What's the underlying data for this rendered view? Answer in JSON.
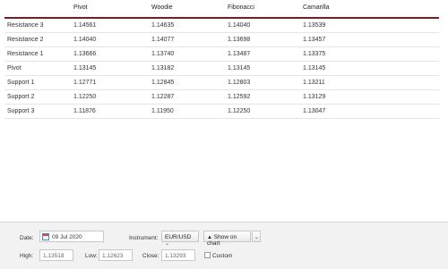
{
  "table": {
    "columns": [
      "",
      "Pivot",
      "Woodie",
      "Fibonacci",
      "Camarilla"
    ],
    "rows": [
      {
        "label": "Resistance 3",
        "pivot": "1.14561",
        "woodie": "1.14635",
        "fibonacci": "1.14040",
        "camarilla": "1.13539"
      },
      {
        "label": "Resistance 2",
        "pivot": "1.14040",
        "woodie": "1.14077",
        "fibonacci": "1.13698",
        "camarilla": "1.13457"
      },
      {
        "label": "Resistance 1",
        "pivot": "1.13666",
        "woodie": "1.13740",
        "fibonacci": "1.13487",
        "camarilla": "1.13375"
      },
      {
        "label": "Pivot",
        "pivot": "1.13145",
        "woodie": "1.13182",
        "fibonacci": "1.13145",
        "camarilla": "1.13145"
      },
      {
        "label": "Support 1",
        "pivot": "1.12771",
        "woodie": "1.12845",
        "fibonacci": "1.12803",
        "camarilla": "1.13211"
      },
      {
        "label": "Support 2",
        "pivot": "1.12250",
        "woodie": "1.12287",
        "fibonacci": "1.12592",
        "camarilla": "1.13129"
      },
      {
        "label": "Support 3",
        "pivot": "1.11876",
        "woodie": "1.11950",
        "fibonacci": "1.12250",
        "camarilla": "1.13047"
      }
    ]
  },
  "controls": {
    "date_label": "Date:",
    "date_value": "09 Jul 2020",
    "instrument_label": "Instrument:",
    "instrument_value": "EUR/USD",
    "show_on_chart_label": "Show on chart",
    "high_label": "High:",
    "high_value": "1,13518",
    "low_label": "Low:",
    "low_value": "1,12623",
    "close_label": "Close:",
    "close_value": "1,13293",
    "custom_label": "Custom"
  },
  "icons": {
    "calendar": "calendar-icon",
    "dropdown": "chevron-down-icon",
    "chart": "chart-icon"
  },
  "colors": {
    "header_rule": "#7a1f1f",
    "panel_background": "#f2f2f2"
  }
}
